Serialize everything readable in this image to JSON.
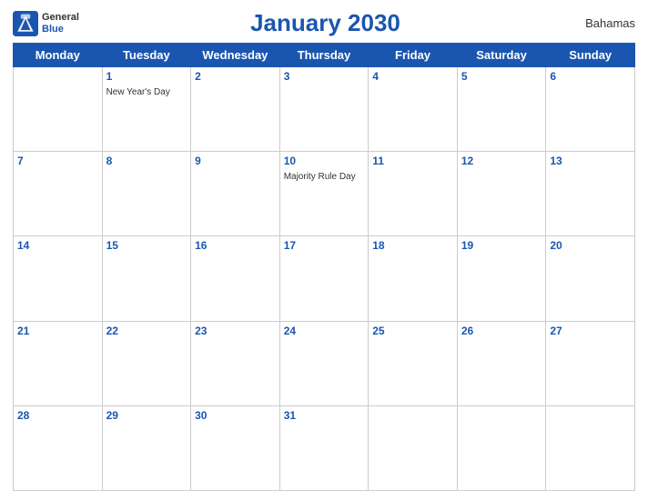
{
  "logo": {
    "general": "General",
    "blue": "Blue"
  },
  "title": "January 2030",
  "country": "Bahamas",
  "days_of_week": [
    "Monday",
    "Tuesday",
    "Wednesday",
    "Thursday",
    "Friday",
    "Saturday",
    "Sunday"
  ],
  "weeks": [
    [
      {
        "date": "",
        "holiday": ""
      },
      {
        "date": "1",
        "holiday": "New Year's Day"
      },
      {
        "date": "2",
        "holiday": ""
      },
      {
        "date": "3",
        "holiday": ""
      },
      {
        "date": "4",
        "holiday": ""
      },
      {
        "date": "5",
        "holiday": ""
      },
      {
        "date": "6",
        "holiday": ""
      }
    ],
    [
      {
        "date": "7",
        "holiday": ""
      },
      {
        "date": "8",
        "holiday": ""
      },
      {
        "date": "9",
        "holiday": ""
      },
      {
        "date": "10",
        "holiday": "Majority Rule Day"
      },
      {
        "date": "11",
        "holiday": ""
      },
      {
        "date": "12",
        "holiday": ""
      },
      {
        "date": "13",
        "holiday": ""
      }
    ],
    [
      {
        "date": "14",
        "holiday": ""
      },
      {
        "date": "15",
        "holiday": ""
      },
      {
        "date": "16",
        "holiday": ""
      },
      {
        "date": "17",
        "holiday": ""
      },
      {
        "date": "18",
        "holiday": ""
      },
      {
        "date": "19",
        "holiday": ""
      },
      {
        "date": "20",
        "holiday": ""
      }
    ],
    [
      {
        "date": "21",
        "holiday": ""
      },
      {
        "date": "22",
        "holiday": ""
      },
      {
        "date": "23",
        "holiday": ""
      },
      {
        "date": "24",
        "holiday": ""
      },
      {
        "date": "25",
        "holiday": ""
      },
      {
        "date": "26",
        "holiday": ""
      },
      {
        "date": "27",
        "holiday": ""
      }
    ],
    [
      {
        "date": "28",
        "holiday": ""
      },
      {
        "date": "29",
        "holiday": ""
      },
      {
        "date": "30",
        "holiday": ""
      },
      {
        "date": "31",
        "holiday": ""
      },
      {
        "date": "",
        "holiday": ""
      },
      {
        "date": "",
        "holiday": ""
      },
      {
        "date": "",
        "holiday": ""
      }
    ]
  ]
}
